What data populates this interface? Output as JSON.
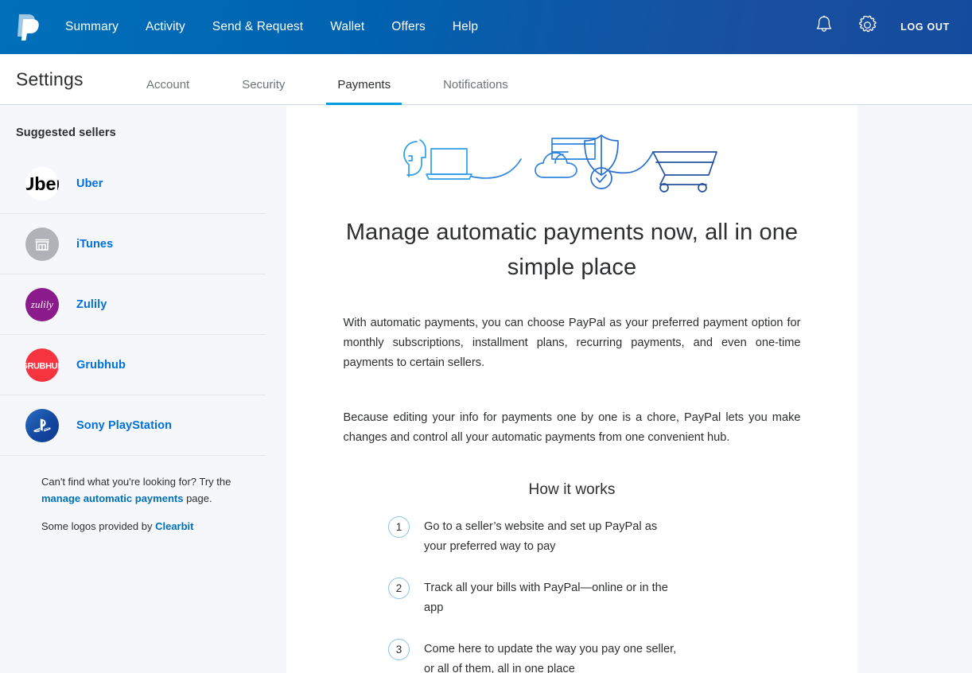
{
  "topnav": {
    "logo_icon": "paypal-logo",
    "links": [
      {
        "label": "Summary"
      },
      {
        "label": "Activity"
      },
      {
        "label": "Send & Request"
      },
      {
        "label": "Wallet"
      },
      {
        "label": "Offers"
      },
      {
        "label": "Help"
      }
    ],
    "bell_icon": "bell-icon",
    "gear_icon": "gear-icon",
    "logout_label": "LOG OUT",
    "colors": {
      "gradient_start": "#0070BA",
      "gradient_end": "#144B9E",
      "text": "#FFFFFF"
    }
  },
  "settings": {
    "title": "Settings",
    "tabs": [
      {
        "label": "Account",
        "active": false
      },
      {
        "label": "Security",
        "active": false
      },
      {
        "label": "Payments",
        "active": true
      },
      {
        "label": "Notifications",
        "active": false
      }
    ],
    "active_tab": "Payments",
    "accent_color": "#009CDE"
  },
  "sidebar": {
    "heading": "Suggested sellers",
    "sellers": [
      {
        "name": "Uber",
        "logo_icon": "uber-logo",
        "logo_bg": "#FFFFFF",
        "logo_fg": "#000000"
      },
      {
        "name": "iTunes",
        "logo_icon": "storefront-placeholder-icon",
        "logo_bg": "#AFB3B8",
        "logo_fg": "#FFFFFF"
      },
      {
        "name": "Zulily",
        "logo_icon": "zulily-logo",
        "logo_bg": "#8B1A8B",
        "logo_fg": "#FFFFFF"
      },
      {
        "name": "Grubhub",
        "logo_icon": "grubhub-logo",
        "logo_bg": "#F63440",
        "logo_fg": "#FFFFFF"
      },
      {
        "name": "Sony PlayStation",
        "logo_icon": "playstation-logo",
        "logo_bg": "#1A4F9F",
        "logo_fg": "#FFFFFF"
      }
    ],
    "footer": {
      "line1_prefix": "Can't find what you're looking for? Try the ",
      "line1_link": "manage automatic payments",
      "line1_suffix": " page.",
      "line2_prefix": "Some logos provided by ",
      "line2_link": "Clearbit"
    },
    "link_color": "#0070BA"
  },
  "main": {
    "hero_icon": "automatic-payments-flow-illustration",
    "headline": "Manage automatic payments now, all in one simple place",
    "paragraph1": "With automatic payments, you can choose PayPal as your preferred payment option for monthly subscriptions, installment plans, recurring payments, and even one-time payments to certain sellers.",
    "paragraph2": "Because editing your info for payments one by one is a chore, PayPal lets you make changes and control all your automatic payments from one convenient hub.",
    "how_it_works_title": "How it works",
    "steps": [
      {
        "number": "1",
        "text": "Go to a seller’s website and set up PayPal as your preferred way to pay"
      },
      {
        "number": "2",
        "text": "Track all your bills with PayPal—online or in the app"
      },
      {
        "number": "3",
        "text": "Come here to update the way you pay one seller, or all of them, all in one place"
      }
    ]
  }
}
